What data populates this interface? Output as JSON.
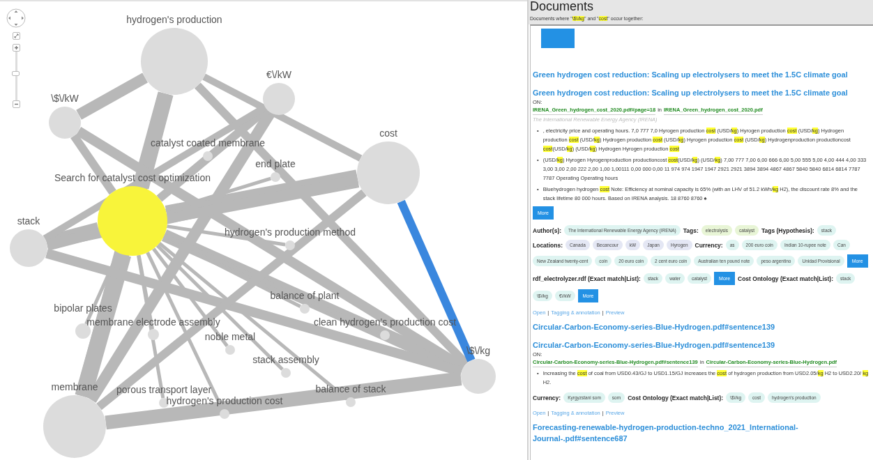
{
  "graph": {
    "controls": {
      "zoom": {
        "level": 0.55
      }
    },
    "nodes": [
      {
        "label": "hydrogen's production",
        "kind": "term"
      },
      {
        "label": "€\\/kW",
        "kind": "term"
      },
      {
        "label": "\\$\\/kW",
        "kind": "term"
      },
      {
        "label": "catalyst coated membrane",
        "kind": "term"
      },
      {
        "label": "cost",
        "kind": "term"
      },
      {
        "label": "end plate",
        "kind": "term"
      },
      {
        "label": "Search for catalyst cost optimization",
        "kind": "query"
      },
      {
        "label": "stack",
        "kind": "term"
      },
      {
        "label": "hydrogen's production method",
        "kind": "term"
      },
      {
        "label": "balance of plant",
        "kind": "term"
      },
      {
        "label": "bipolar plates",
        "kind": "term"
      },
      {
        "label": "membrane electrode assembly",
        "kind": "term"
      },
      {
        "label": "clean hydrogen's production cost",
        "kind": "term"
      },
      {
        "label": "noble metal",
        "kind": "term"
      },
      {
        "label": "stack assembly",
        "kind": "term"
      },
      {
        "label": "\\$\\/kg",
        "kind": "term"
      },
      {
        "label": "membrane",
        "kind": "term"
      },
      {
        "label": "porous transport layer",
        "kind": "term"
      },
      {
        "label": "hydrogen's production cost",
        "kind": "term"
      },
      {
        "label": "balance of stack",
        "kind": "term"
      }
    ],
    "highlighted_link": {
      "selected": true
    }
  },
  "documents_panel": {
    "title": "Documents",
    "subtitle": [
      {
        "text": "Documents where \"",
        "highlighted": false
      },
      {
        "text": "\\$\\/kg",
        "highlighted": true
      },
      {
        "text": "\" and \"",
        "highlighted": false
      },
      {
        "text": "cost",
        "highlighted": true
      },
      {
        "text": "\" occur together:",
        "highlighted": false
      }
    ],
    "documents": [
      {
        "heading": "Green hydrogen cost reduction: Scaling up electrolysers to meet the 1.5C climate goal",
        "title": "Green hydrogen cost reduction: Scaling up electrolysers to meet the 1.5C climate goal",
        "on_label": "ON:",
        "source_link": "IRENA_Green_hydrogen_cost_2020.pdf#page=18",
        "in_word": "in",
        "file_link": "IRENA_Green_hydrogen_cost_2020.pdf",
        "publisher": "The International Renewable Energy Agency (IRENA)",
        "bullet": "•",
        "snippets": [
          [
            {
              "text": ", electricity price and operating hours. 7,0 777 7,0 Hyrogen production ",
              "highlighted": false
            },
            {
              "text": "cost",
              "highlighted": true
            },
            {
              "text": " (USD/",
              "highlighted": false
            },
            {
              "text": "kg",
              "highlighted": true
            },
            {
              "text": ") Hyrogen production ",
              "highlighted": false
            },
            {
              "text": "cost",
              "highlighted": true
            },
            {
              "text": " (USD/",
              "highlighted": false
            },
            {
              "text": "kg",
              "highlighted": true
            },
            {
              "text": ") Hydrogen production ",
              "highlighted": false
            },
            {
              "text": "cost",
              "highlighted": true
            },
            {
              "text": " (USD/",
              "highlighted": false
            },
            {
              "text": "kg",
              "highlighted": true
            },
            {
              "text": ") Hydrogen production ",
              "highlighted": false
            },
            {
              "text": "cost",
              "highlighted": true
            },
            {
              "text": " (USD/",
              "highlighted": false
            },
            {
              "text": "kg",
              "highlighted": true
            },
            {
              "text": ") Hyrogen production ",
              "highlighted": false
            },
            {
              "text": "cost",
              "highlighted": true
            },
            {
              "text": " (USD/",
              "highlighted": false
            },
            {
              "text": "kg",
              "highlighted": true
            },
            {
              "text": ") Hydrogenproduction productioncost ",
              "highlighted": false
            },
            {
              "text": "cost",
              "highlighted": true
            },
            {
              "text": "(USD/",
              "highlighted": false
            },
            {
              "text": "kg",
              "highlighted": true
            },
            {
              "text": ") (USD/",
              "highlighted": false
            },
            {
              "text": "kg",
              "highlighted": true
            },
            {
              "text": ") Hydrogen Hyrogen production ",
              "highlighted": false
            },
            {
              "text": "cost",
              "highlighted": true
            }
          ],
          [
            {
              "text": "(USD/",
              "highlighted": false
            },
            {
              "text": "kg",
              "highlighted": true
            },
            {
              "text": ") Hyrogen Hyrogenproduction productioncost ",
              "highlighted": false
            },
            {
              "text": "cost",
              "highlighted": true
            },
            {
              "text": "(USD/",
              "highlighted": false
            },
            {
              "text": "kg",
              "highlighted": true
            },
            {
              "text": ") (USD/",
              "highlighted": false
            },
            {
              "text": "kg",
              "highlighted": true
            },
            {
              "text": ") 7,00 777 7,00 6,00 666 6,00 5,00 555 5,00 4,00 444 4,00 333 3,00 3,00 2,00 222 2,00 1,00 1,00111 0,00 000 0,00 11 974 974 1947 1947 2921 2921 3894 3894 4867 4867 5840 5840 6814 6814 7787 7787 Operating Operating hours",
              "highlighted": false
            }
          ],
          [
            {
              "text": "Bluehydrogen hydrogen ",
              "highlighted": false
            },
            {
              "text": "cost",
              "highlighted": true
            },
            {
              "text": " Note: Efficiency at nominal capacity is 65% (with an LHV of 51.2 kWh/",
              "highlighted": false
            },
            {
              "text": "kg",
              "highlighted": true
            },
            {
              "text": " H2), the discount rate 8% and the stack lifetime 80 000 hours. Based on IRENA analysis. 18 8760 8760 ♠",
              "highlighted": false
            }
          ]
        ],
        "more_button": "More",
        "facets": [
          {
            "label": "Author(s):",
            "kind": "author",
            "chips": [
              "The International Renewable Energy Agency (IRENA)"
            ]
          },
          {
            "label": "Tags:",
            "kind": "tag",
            "chips": [
              "electrolysis",
              "catalyst"
            ]
          },
          {
            "label": "Tags (Hypothesis):",
            "kind": "hypothesis",
            "chips": [
              "stack"
            ]
          },
          {
            "label": "Locations:",
            "kind": "location",
            "chips": [
              "Canada",
              "Becancour",
              "kW",
              "Japan",
              "Hyrogen"
            ]
          },
          {
            "label": "Currency:",
            "kind": "currency",
            "chips": [
              "as",
              "200 euro coin",
              "Indian 10-rupee note",
              "Can",
              "New Zealand twenty-cent",
              "coin",
              "20 euro coin",
              "2 cent euro coin",
              "Australian ten pound note",
              "peso argentino",
              "Unidad Provisional"
            ],
            "more_button": "More"
          },
          {
            "label": "rdf_electrolyzer.rdf (Exact match|List):",
            "kind": "ontology",
            "chips": [
              "stack",
              "water",
              "catalyst"
            ],
            "more_button": "More"
          },
          {
            "label": "Cost Ontology (Exact match|List):",
            "kind": "ontology",
            "chips": [
              "stack",
              "\\$\\/kg",
              "€\\/kW"
            ],
            "more_button": "More"
          }
        ],
        "actions": [
          "Open",
          "Tagging & annotation",
          "Preview"
        ],
        "action_separator": "|"
      },
      {
        "heading": "Circular-Carbon-Economy-series-Blue-Hydrogen.pdf#sentence139",
        "title": "Circular-Carbon-Economy-series-Blue-Hydrogen.pdf#sentence139",
        "on_label": "ON:",
        "source_link": "Circular-Carbon-Economy-series-Blue-Hydrogen.pdf#sentence139",
        "in_word": "in",
        "file_link": "Circular-Carbon-Economy-series-Blue-Hydrogen.pdf",
        "bullet": "•",
        "snippets": [
          [
            {
              "text": "Increasing the ",
              "highlighted": false
            },
            {
              "text": "cost",
              "highlighted": true
            },
            {
              "text": " of coal from USD0.43/GJ to USD1.15/GJ increases the ",
              "highlighted": false
            },
            {
              "text": "cost",
              "highlighted": true
            },
            {
              "text": " of hydrogen production from USD2.05/",
              "highlighted": false
            },
            {
              "text": "kg",
              "highlighted": true
            },
            {
              "text": " H2 to USD2.20/ ",
              "highlighted": false
            },
            {
              "text": "kg",
              "highlighted": true
            },
            {
              "text": " H2.",
              "highlighted": false
            }
          ]
        ],
        "facets": [
          {
            "label": "Currency:",
            "kind": "currency",
            "chips": [
              "Kyrgyzstani som",
              "som"
            ]
          },
          {
            "label": "Cost Ontology (Exact match|List):",
            "kind": "ontology",
            "chips": [
              "\\$\\/kg",
              "cost",
              "hydrogen's production"
            ]
          }
        ],
        "actions": [
          "Open",
          "Tagging & annotation",
          "Preview"
        ],
        "action_separator": "|"
      },
      {
        "heading": "Forecasting-renewable-hydrogen-production-techno_2021_International-Journal-.pdf#sentence687"
      }
    ]
  }
}
